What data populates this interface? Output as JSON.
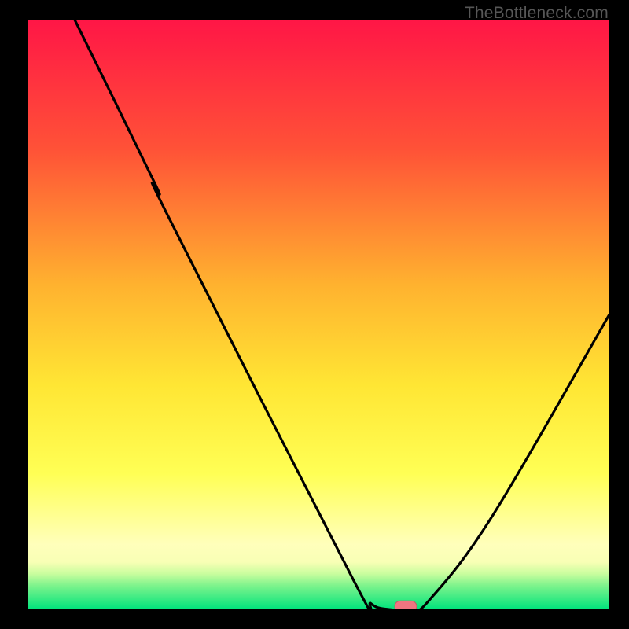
{
  "watermark": "TheBottleneck.com",
  "colors": {
    "background": "#000000",
    "watermark_text": "#575757",
    "gradient_top": "#ff1646",
    "gradient_mid1": "#ff8a30",
    "gradient_mid2": "#ffd934",
    "gradient_yellow": "#ffff46",
    "gradient_pale": "#ffffbb",
    "gradient_green": "#00e37c",
    "curve": "#000000",
    "marker_fill": "#ef7580",
    "marker_stroke": "#c25964"
  },
  "chart_data": {
    "type": "line",
    "title": "",
    "xlabel": "",
    "ylabel": "",
    "xlim": [
      0,
      100
    ],
    "ylim": [
      0,
      100
    ],
    "curve": [
      {
        "x": 8.1,
        "y": 100.0
      },
      {
        "x": 22.0,
        "y": 72.0
      },
      {
        "x": 24.0,
        "y": 67.0
      },
      {
        "x": 56.0,
        "y": 5.0
      },
      {
        "x": 59.0,
        "y": 1.0
      },
      {
        "x": 62.0,
        "y": 0.0
      },
      {
        "x": 66.0,
        "y": 0.0
      },
      {
        "x": 69.0,
        "y": 1.5
      },
      {
        "x": 80.0,
        "y": 16.0
      },
      {
        "x": 100.0,
        "y": 50.0
      }
    ],
    "marker": {
      "x": 65.0,
      "y": 0.5
    },
    "gradient_stops": [
      {
        "offset": 0,
        "color": "#ff1646"
      },
      {
        "offset": 22,
        "color": "#ff5237"
      },
      {
        "offset": 45,
        "color": "#ffb22f"
      },
      {
        "offset": 62,
        "color": "#ffe634"
      },
      {
        "offset": 77,
        "color": "#ffff55"
      },
      {
        "offset": 89,
        "color": "#ffffbb"
      },
      {
        "offset": 92,
        "color": "#f8ffb5"
      },
      {
        "offset": 94,
        "color": "#c8fd9e"
      },
      {
        "offset": 96,
        "color": "#7df38c"
      },
      {
        "offset": 100,
        "color": "#00e37c"
      }
    ]
  }
}
